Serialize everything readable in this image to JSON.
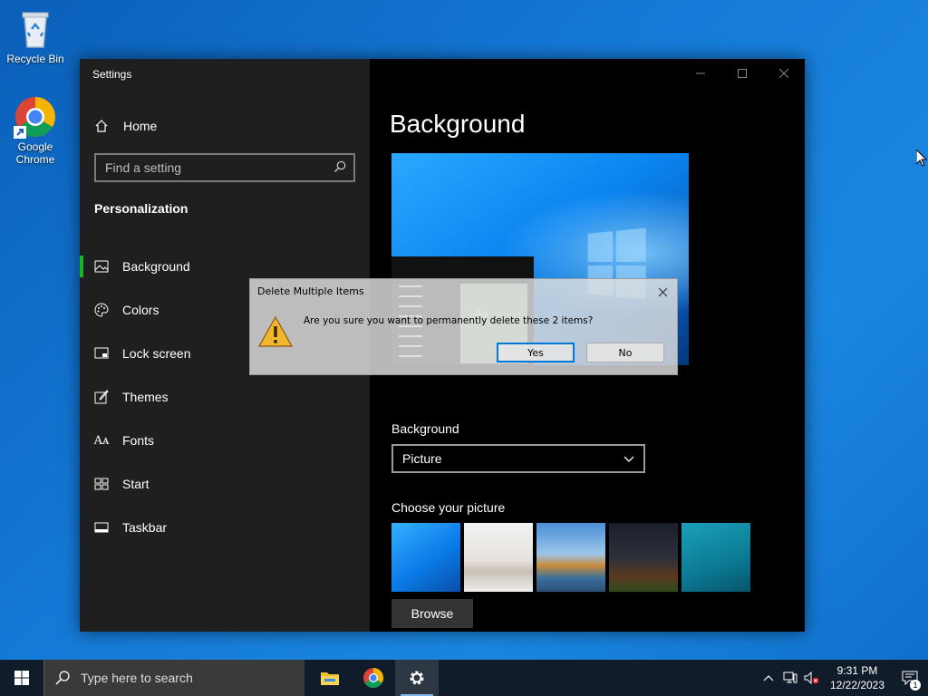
{
  "desktop": {
    "icons": [
      {
        "label": "Recycle Bin",
        "icon": "recycle-bin-icon"
      },
      {
        "label": "Google Chrome",
        "icon": "chrome-icon"
      }
    ]
  },
  "settings_window": {
    "title": "Settings",
    "home_label": "Home",
    "search_placeholder": "Find a setting",
    "section_title": "Personalization",
    "nav_items": [
      {
        "label": "Background",
        "icon": "picture-icon",
        "active": true
      },
      {
        "label": "Colors",
        "icon": "palette-icon",
        "active": false
      },
      {
        "label": "Lock screen",
        "icon": "lock-screen-icon",
        "active": false
      },
      {
        "label": "Themes",
        "icon": "themes-icon",
        "active": false
      },
      {
        "label": "Fonts",
        "icon": "fonts-icon",
        "active": false
      },
      {
        "label": "Start",
        "icon": "start-icon",
        "active": false
      },
      {
        "label": "Taskbar",
        "icon": "taskbar-icon",
        "active": false
      }
    ],
    "content": {
      "page_title": "Background",
      "preview_tile_text": "Aa",
      "background_label": "Background",
      "background_value": "Picture",
      "choose_picture_label": "Choose your picture",
      "browse_label": "Browse"
    }
  },
  "dialog": {
    "title": "Delete Multiple Items",
    "message": "Are you sure you want to permanently delete these 2 items?",
    "yes_label": "Yes",
    "no_label": "No"
  },
  "taskbar": {
    "search_placeholder": "Type here to search",
    "apps": [
      "file-explorer-icon",
      "chrome-icon",
      "settings-gear-icon"
    ],
    "clock_time": "9:31 PM",
    "clock_date": "12/22/2023",
    "notification_count": "1"
  },
  "colors": {
    "accent": "#1db41d",
    "dialog_default_border": "#0078d7"
  }
}
